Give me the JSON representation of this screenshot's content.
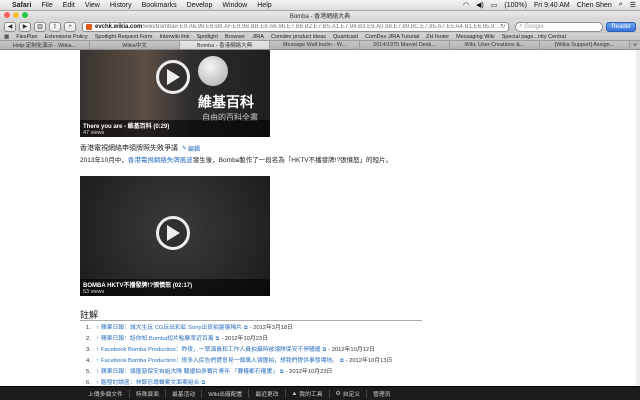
{
  "menubar": {
    "app": "Safari",
    "items": [
      "File",
      "Edit",
      "View",
      "History",
      "Bookmarks",
      "Develop",
      "Window",
      "Help"
    ],
    "battery": "(100%)",
    "clock": "Fri 9:40 AM",
    "user": "Chen Shen"
  },
  "window": {
    "title": "Bomba - 香港網絡大典"
  },
  "toolbar": {
    "url_host": "evchk.wikia.com",
    "url_path": "/wiki/Bomba#.E9.A6.99.E6.B8.AF.E9.9B.BB.E8.A6.96.E7.B6.B2.E7.B5.A1.E7.94.B3.E9.A0.98.E7.89.8C.E7.85.A7.E5.A4.B1.E6.95.97.E7.88.AD.E8.AD.B0",
    "search_placeholder": "Google",
    "reader_label": "Reader"
  },
  "bookmarks": [
    "FlexPlan",
    "Extensions Policy",
    "Spotlight Request Form",
    "Interwiki link",
    "Spotlight",
    "Browser",
    "JIRA",
    "Comdev product ideas",
    "Quantcast",
    "ComDev JIRA Tutorial",
    "ZH footer",
    "Messaging Wiki",
    "Special page...nity Central"
  ],
  "tabs": [
    {
      "label": "Help:定制化演示 - Wikia...",
      "active": false
    },
    {
      "label": "Wikia中文",
      "active": false
    },
    {
      "label": "Bomba - 香港網絡大典",
      "active": true
    },
    {
      "label": "Message Wall:Inolin - W...",
      "active": false
    },
    {
      "label": "2014/1975 Marvel Desk...",
      "active": false
    },
    {
      "label": "Wiki, User Creations &...",
      "active": false
    },
    {
      "label": "[Wikia Support] Assign...",
      "active": false
    }
  ],
  "video1": {
    "title": "There you are - 維基百科 (0:29)",
    "views": "47 views",
    "overlay_big": "維基百科",
    "overlay_small": "自由的百科全書"
  },
  "section_heading": "香港電視網絡申領牌照失敗爭議",
  "edit_label": "編輯",
  "paragraph": {
    "prefix": "2013年10月中，",
    "link": "香港電視網絡失牌風波",
    "suffix": "發生後，Bomba製作了一段名為「HKTV不播發牌!?張憤怒」的短片。"
  },
  "video2": {
    "title": "BOMBA HKTV不播發牌!?張憤怒 (02:17)",
    "views": "53 views"
  },
  "refs_title": "註解",
  "refs": [
    {
      "num": "1.",
      "link": "蘋果日報：城大生玩 CG玩出彩虹 Sony出資拍變猿稀片",
      "date": " - 2012年3月18日"
    },
    {
      "num": "2.",
      "link": "蘋果日報：話你知 Bomba短片點擊率近百萬",
      "date": " - 2012年10月23日"
    },
    {
      "num": "3.",
      "link": "Facebook Bomba Production：昨夜，一眾演員和工作人員拍攝時被領隊保安不停騷擾",
      "date": " - 2012年10月12日"
    },
    {
      "num": "4.",
      "link": "Facebook Bomba Production：很多人民告們提意見一個萬人領匯拍，想我們提供事發場地。",
      "date": " - 2012年10月13日"
    },
    {
      "num": "5.",
      "link": "蘋果日報：領匯惡保安自組大隊 騷擾拍參賽片青年 「賽權都冇權實」",
      "date": " - 2012年10月23日"
    },
    {
      "num": "6.",
      "link": "腦發討論區：林鄭忍尋聲案文面案組合",
      "date": ""
    }
  ],
  "footer": [
    "上傳多個文件",
    "特殊頁面",
    "最基活动",
    "Wiki出廠配置",
    "最近更改",
    "我的工具",
    "自定义",
    "管理员"
  ]
}
